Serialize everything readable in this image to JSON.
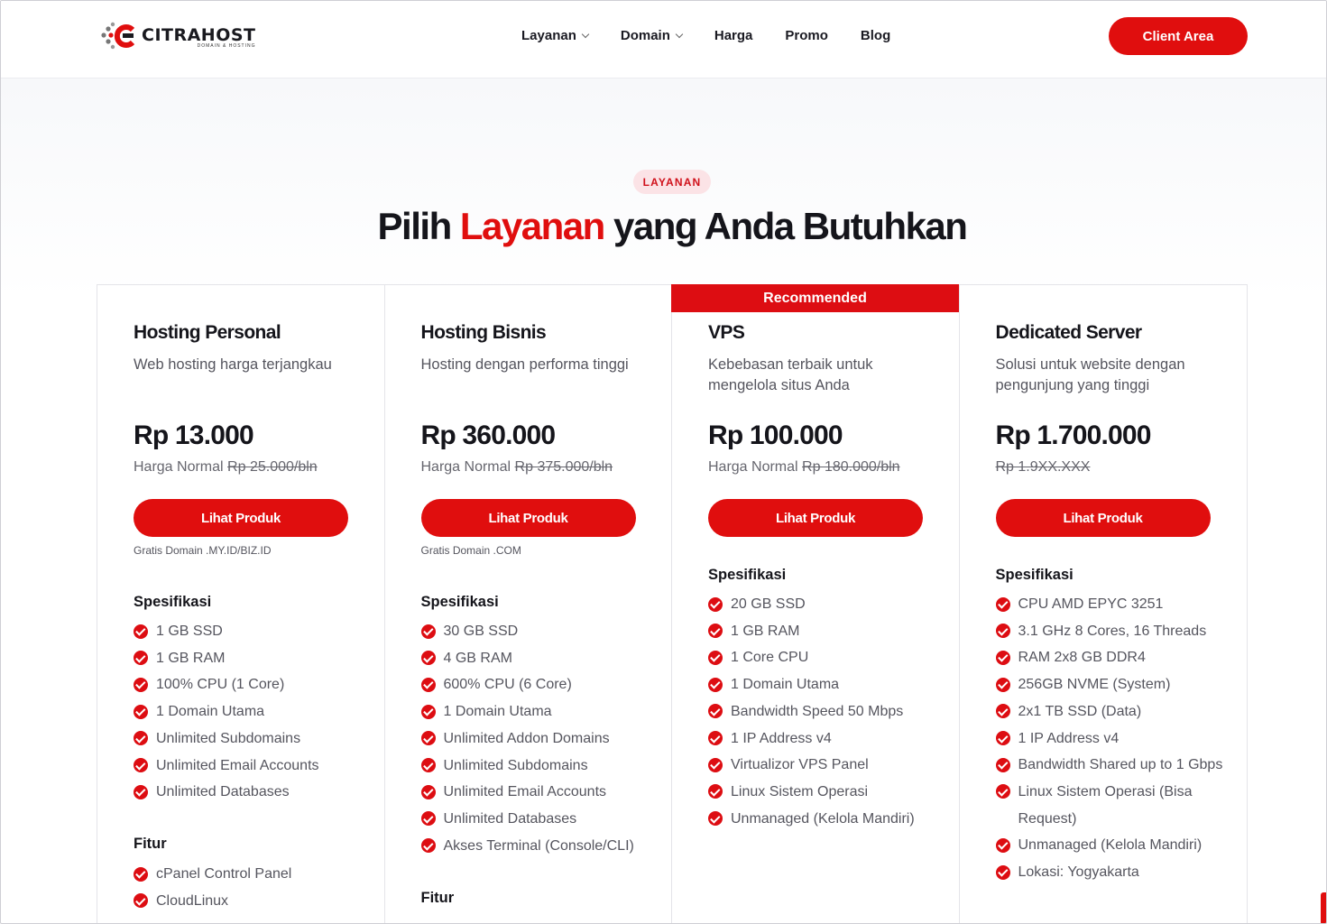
{
  "brand": {
    "name": "CITRAHOST",
    "tagline": "DOMAIN & HOSTING",
    "accent_color": "#e00e0e"
  },
  "nav": {
    "items": [
      {
        "label": "Layanan",
        "has_dropdown": true
      },
      {
        "label": "Domain",
        "has_dropdown": true
      },
      {
        "label": "Harga",
        "has_dropdown": false
      },
      {
        "label": "Promo",
        "has_dropdown": false
      },
      {
        "label": "Blog",
        "has_dropdown": false
      }
    ],
    "client_area_label": "Client Area"
  },
  "hero": {
    "badge": "LAYANAN",
    "title_prefix": "Pilih",
    "title_accent": "Layanan",
    "title_suffix": "yang Anda Butuhkan"
  },
  "plans": [
    {
      "name": "Hosting Personal",
      "description": "Web hosting harga terjangkau",
      "price": "Rp 13.000",
      "normal_label": "Harga Normal",
      "normal_price": "Rp 25.000/bln",
      "button": "Lihat Produk",
      "note": "Gratis Domain .MY.ID/BIZ.ID",
      "specs_heading": "Spesifikasi",
      "specs": [
        "1 GB SSD",
        "1 GB RAM",
        "100% CPU (1 Core)",
        "1 Domain Utama",
        "Unlimited Subdomains",
        "Unlimited Email Accounts",
        "Unlimited Databases"
      ],
      "features_heading": "Fitur",
      "features": [
        "cPanel Control Panel",
        "CloudLinux"
      ]
    },
    {
      "name": "Hosting Bisnis",
      "description": "Hosting dengan performa tinggi",
      "price": "Rp 360.000",
      "normal_label": "Harga Normal",
      "normal_price": "Rp 375.000/bln",
      "button": "Lihat Produk",
      "note": "Gratis Domain .COM",
      "specs_heading": "Spesifikasi",
      "specs": [
        "30 GB SSD",
        "4 GB RAM",
        "600% CPU (6 Core)",
        "1 Domain Utama",
        "Unlimited Addon Domains",
        "Unlimited Subdomains",
        "Unlimited Email Accounts",
        "Unlimited Databases",
        "Akses Terminal (Console/CLI)"
      ],
      "features_heading": "Fitur",
      "features": []
    },
    {
      "name": "VPS",
      "ribbon": "Recommended",
      "description": "Kebebasan terbaik untuk mengelola situs Anda",
      "price": "Rp 100.000",
      "normal_label": "Harga Normal",
      "normal_price": "Rp 180.000/bln",
      "button": "Lihat Produk",
      "specs_heading": "Spesifikasi",
      "specs": [
        "20 GB SSD",
        "1 GB RAM",
        "1 Core CPU",
        "1 Domain Utama",
        "Bandwidth Speed 50 Mbps",
        "1 IP Address v4",
        "Virtualizor VPS Panel",
        "Linux Sistem Operasi",
        "Unmanaged (Kelola Mandiri)"
      ]
    },
    {
      "name": "Dedicated Server",
      "description": "Solusi untuk website dengan pengunjung yang tinggi",
      "price": "Rp 1.700.000",
      "normal_price": "Rp 1.9XX.XXX",
      "button": "Lihat Produk",
      "specs_heading": "Spesifikasi",
      "specs": [
        "CPU AMD EPYC 3251",
        "3.1 GHz 8 Cores, 16 Threads",
        "RAM 2x8 GB DDR4",
        "256GB NVME (System)",
        "2x1 TB SSD (Data)",
        "1 IP Address v4",
        "Bandwidth Shared up to 1 Gbps",
        "Linux Sistem Operasi (Bisa Request)",
        "Unmanaged (Kelola Mandiri)",
        "Lokasi: Yogyakarta"
      ]
    }
  ]
}
